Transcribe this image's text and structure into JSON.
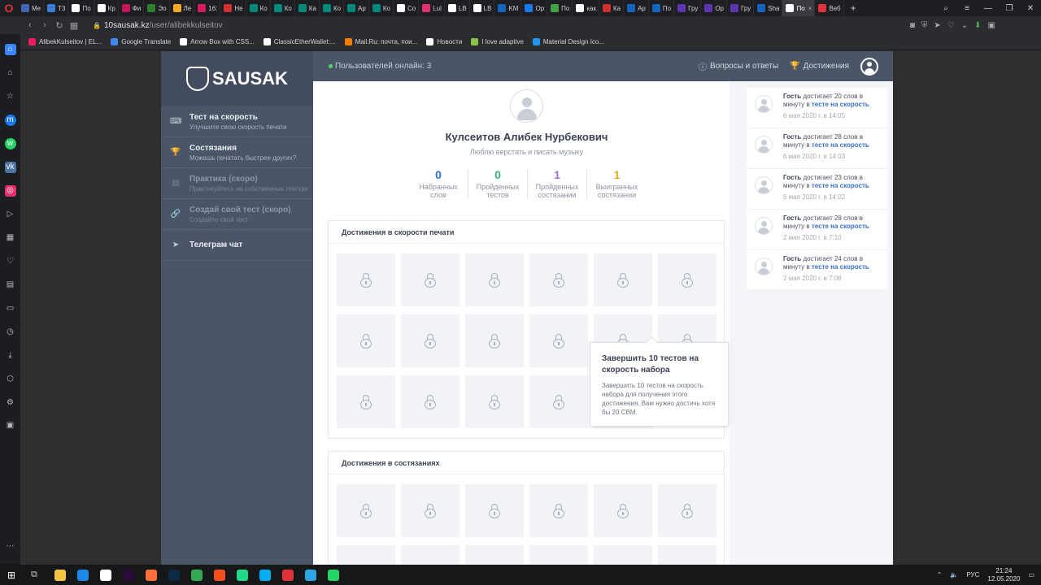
{
  "browser": {
    "tabs": [
      {
        "label": "Me",
        "color": "#4267b2"
      },
      {
        "label": "Т3",
        "color": "#3a7bd5"
      },
      {
        "label": "По",
        "color": "#ffffff"
      },
      {
        "label": "Кр",
        "color": "#ffffff"
      },
      {
        "label": "Фи",
        "color": "#c2185b"
      },
      {
        "label": "Эо",
        "color": "#2e7d32"
      },
      {
        "label": "Ле",
        "color": "#f9a825"
      },
      {
        "label": "16:",
        "color": "#d81b60"
      },
      {
        "label": "Не",
        "color": "#d32f2f"
      },
      {
        "label": "Ко",
        "color": "#00897b"
      },
      {
        "label": "Ко",
        "color": "#00897b"
      },
      {
        "label": "Ка",
        "color": "#00897b"
      },
      {
        "label": "Ко",
        "color": "#00897b"
      },
      {
        "label": "Ар",
        "color": "#00897b"
      },
      {
        "label": "Ко",
        "color": "#00897b"
      },
      {
        "label": "Со",
        "color": "#ffffff"
      },
      {
        "label": "Lul",
        "color": "#e1306c"
      },
      {
        "label": "LB",
        "color": "#ffffff"
      },
      {
        "label": "LB",
        "color": "#ffffff"
      },
      {
        "label": "KM",
        "color": "#1565c0"
      },
      {
        "label": "Op",
        "color": "#1877f2"
      },
      {
        "label": "По",
        "color": "#43a047"
      },
      {
        "label": "как",
        "color": "#ffffff"
      },
      {
        "label": "Ка",
        "color": "#d32f2f"
      },
      {
        "label": "Ар",
        "color": "#1565c0"
      },
      {
        "label": "По",
        "color": "#1565c0"
      },
      {
        "label": "Гру",
        "color": "#5e35b1"
      },
      {
        "label": "Op",
        "color": "#5e35b1"
      },
      {
        "label": "Гру",
        "color": "#5e35b1"
      },
      {
        "label": "Sha",
        "color": "#1565c0"
      }
    ],
    "active_tab": "По",
    "extra_tab": "Веб",
    "url_host": "10sausak.kz",
    "url_path": "/user/alibekkulseitov",
    "bookmarks": [
      {
        "label": "AlibekKulseitov | EL...",
        "color": "#e91e63"
      },
      {
        "label": "Google Translate",
        "color": "#4285f4"
      },
      {
        "label": "Arrow Box with CSS...",
        "color": "#ffffff"
      },
      {
        "label": "ClassicEtherWallet:...",
        "color": "#ffffff"
      },
      {
        "label": "Mail.Ru: почта, пои...",
        "color": "#f57c00"
      },
      {
        "label": "Новости",
        "color": "#ffffff"
      },
      {
        "label": "I love adaptive",
        "color": "#8bc34a"
      },
      {
        "label": "Material Design Ico...",
        "color": "#2196f3"
      }
    ]
  },
  "site": {
    "logo": "SAUSAK",
    "online_text": "Пользователей онлайн: 3",
    "top_links": {
      "faq": "Вопросы и ответы",
      "achievements": "Достижения"
    },
    "menu": [
      {
        "title": "Тест на скорость",
        "sub": "Улучшите свою скорость печати",
        "icon": "keyboard-icon",
        "disabled": false
      },
      {
        "title": "Состязания",
        "sub": "Можешь печатать быстрее других?",
        "icon": "trophy-icon",
        "disabled": false
      },
      {
        "title": "Практика (скоро)",
        "sub": "Практикуйтесь на собственных текстах",
        "icon": "document-icon",
        "disabled": true
      },
      {
        "title": "Создай свой тест (скоро)",
        "sub": "Создайте свой тест",
        "icon": "link-icon",
        "disabled": true
      },
      {
        "title": "Телеграм чат",
        "sub": "",
        "icon": "send-icon",
        "disabled": false
      }
    ],
    "profile": {
      "name": "Кулсеитов Алибек Нурбекович",
      "bio": "Люблю верстать и писать музыку",
      "stats": [
        {
          "value": "0",
          "label1": "Набранных",
          "label2": "слов",
          "color": "#2f6ecb"
        },
        {
          "value": "0",
          "label1": "Пройденных",
          "label2": "тестов",
          "color": "#3cb371"
        },
        {
          "value": "1",
          "label1": "Пройденных",
          "label2": "состязании",
          "color": "#9b6fd1"
        },
        {
          "value": "1",
          "label1": "Выигранных",
          "label2": "состязании",
          "color": "#e8a823"
        }
      ]
    },
    "speed_achievements": {
      "title": "Достижения в скорости печати",
      "count": 17
    },
    "contest_achievements": {
      "title": "Достижения в состязаниях"
    },
    "tooltip": {
      "title": "Завершить 10 тестов на скорость набора",
      "text": "Завершить 10 тестов на скорость набора для получения этого достижения. Вам нужно достичь хотя бы 20 СВМ."
    },
    "feed": [
      {
        "who": "Гость",
        "pre": "достигает 20 слов в минуту в",
        "link": "тесте на скорость",
        "date": "6 мая 2020 г. в 14:05"
      },
      {
        "who": "Гость",
        "pre": "достигает 28 слов в минуту в",
        "link": "тесте на скорость",
        "date": "6 мая 2020 г. в 14:03"
      },
      {
        "who": "Гость",
        "pre": "достигает 23 слов в минуту в",
        "link": "тесте на скорость",
        "date": "6 мая 2020 г. в 14:02"
      },
      {
        "who": "Гость",
        "pre": "достигает 28 слов в минуту в",
        "link": "тесте на скорость",
        "date": "2 мая 2020 г. в 7:10"
      },
      {
        "who": "Гость",
        "pre": "достигает 24 слов в минуту в",
        "link": "тесте на скорость",
        "date": "2 мая 2020 г. в 7:08"
      }
    ]
  },
  "taskbar": {
    "apps": [
      {
        "name": "file-explorer-icon",
        "color": "#f4c542"
      },
      {
        "name": "edge-icon",
        "color": "#1e88e5"
      },
      {
        "name": "yandex-icon",
        "color": "#ffffff"
      },
      {
        "name": "premiere-icon",
        "color": "#2a0a3a"
      },
      {
        "name": "firefox-icon",
        "color": "#ff7139"
      },
      {
        "name": "photoshop-icon",
        "color": "#0b2a45"
      },
      {
        "name": "chrome-icon",
        "color": "#34a853"
      },
      {
        "name": "figma-icon",
        "color": "#f24e1e"
      },
      {
        "name": "webstorm-icon",
        "color": "#21d789"
      },
      {
        "name": "skype-icon",
        "color": "#00aff0"
      },
      {
        "name": "opera-icon",
        "color": "#e0323a"
      },
      {
        "name": "telegram-icon",
        "color": "#2ca5e0"
      },
      {
        "name": "whatsapp-icon",
        "color": "#25d366"
      }
    ],
    "lang": "РУС",
    "time": "21:24",
    "date": "12.05.2020"
  }
}
